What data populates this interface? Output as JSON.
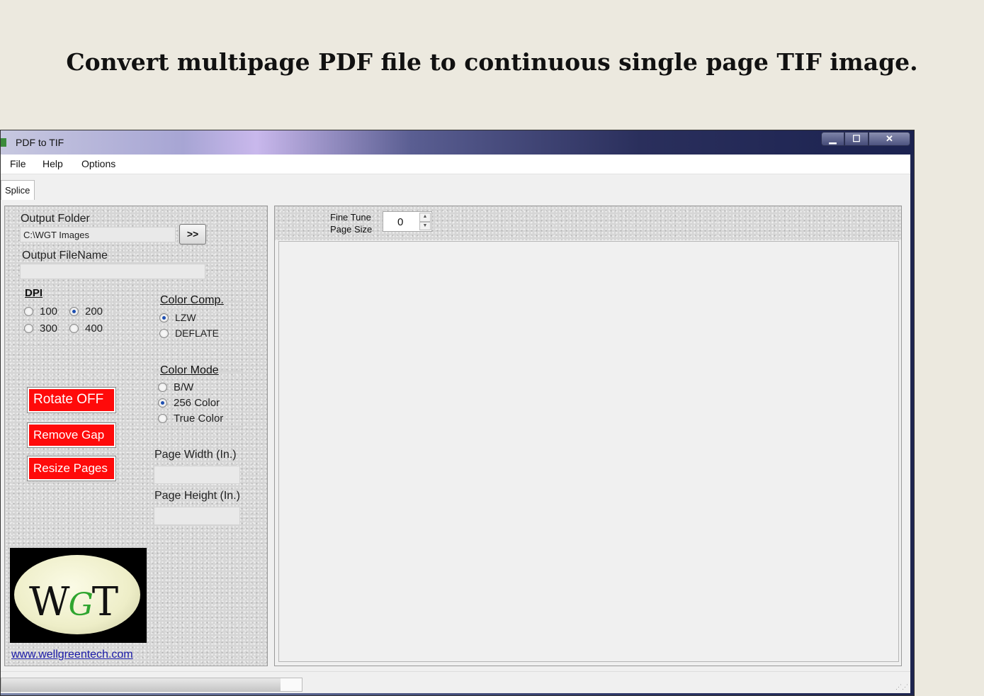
{
  "headline": "Convert multipage PDF file to continuous single page TIF image.",
  "window": {
    "title": "PDF to TIF",
    "min_label": "▁",
    "max_label": "☐",
    "close_label": "✕"
  },
  "menu": {
    "file": "File",
    "help": "Help",
    "options": "Options"
  },
  "tab": {
    "splice": "Splice"
  },
  "left": {
    "output_folder_label": "Output Folder",
    "output_folder_value": "C:\\WGT Images",
    "browse_label": ">>",
    "output_filename_label": "Output FileName",
    "output_filename_value": "",
    "dpi": {
      "title": "DPI",
      "o100": "100",
      "o200": "200",
      "o300": "300",
      "o400": "400",
      "selected": "200"
    },
    "color_comp": {
      "title": "Color Comp.",
      "lzw": "LZW",
      "deflate": "DEFLATE",
      "selected": "LZW"
    },
    "color_mode": {
      "title": "Color Mode",
      "bw": "B/W",
      "c256": "256 Color",
      "true": "True Color",
      "selected": "256 Color"
    },
    "page_width_label": "Page Width (In.)",
    "page_width_value": "",
    "page_height_label": "Page Height (In.)",
    "page_height_value": "",
    "rotate_label": "Rotate OFF",
    "remove_gap_label": "Remove Gap",
    "resize_label": "Resize Pages",
    "website": "www.wellgreentech.com"
  },
  "right": {
    "fine_tune_line1": "Fine Tune",
    "fine_tune_line2": "Page Size",
    "fine_tune_value": "0"
  },
  "colors": {
    "button_red": "#ff0a0a",
    "link_blue": "#1a1aa8"
  },
  "status": {
    "progress": 0.93
  }
}
